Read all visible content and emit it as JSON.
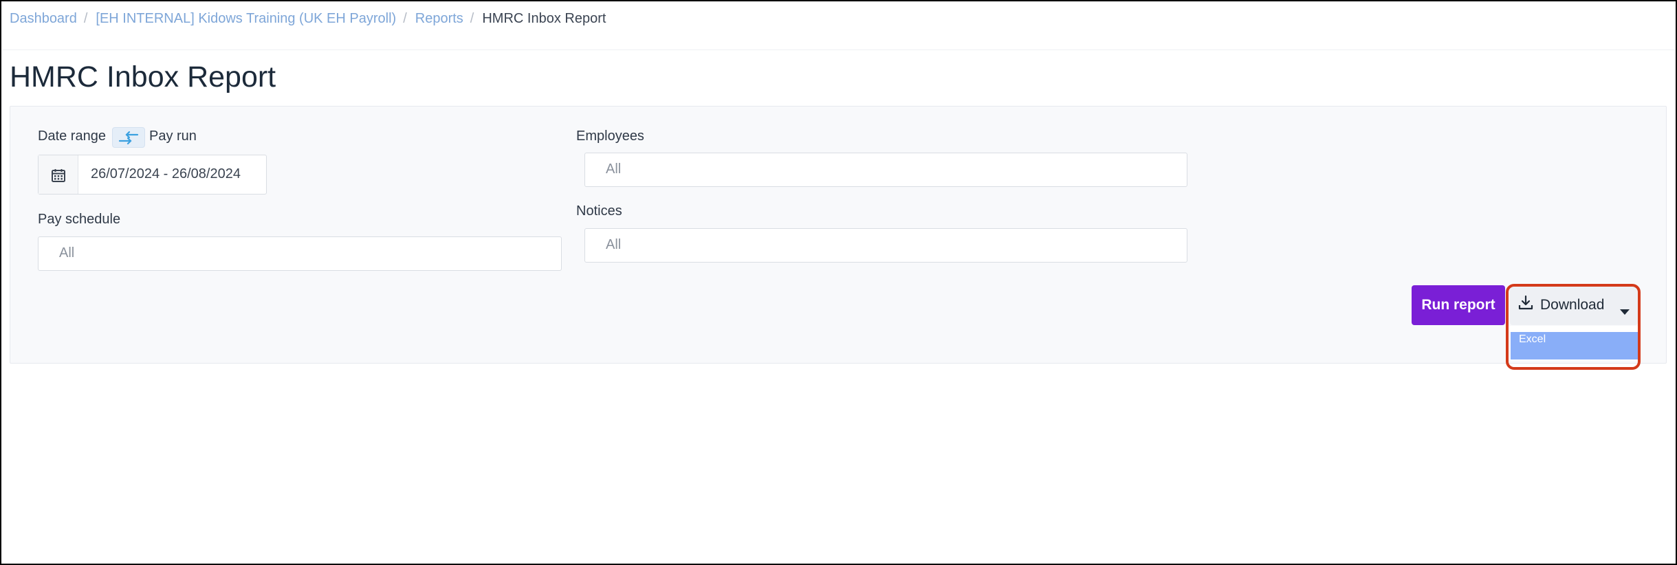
{
  "breadcrumb": {
    "items": [
      "Dashboard",
      "[EH INTERNAL] Kidows Training (UK EH Payroll)",
      "Reports"
    ],
    "separator": "/",
    "current": "HMRC Inbox Report"
  },
  "page": {
    "title": "HMRC Inbox Report"
  },
  "filters": {
    "date_range_label": "Date range",
    "pay_run_label": "Pay run",
    "date_range_value": "26/07/2024 - 26/08/2024",
    "pay_schedule_label": "Pay schedule",
    "pay_schedule_value": "All",
    "employees_label": "Employees",
    "employees_value": "All",
    "notices_label": "Notices",
    "notices_value": "All"
  },
  "actions": {
    "run_report_label": "Run report",
    "download_label": "Download",
    "download_options": [
      "Excel"
    ]
  },
  "colors": {
    "primary": "#7a1fd6",
    "link": "#7ea6d8",
    "dropdown_highlight": "#89aef8",
    "annotation": "#d43a1a"
  },
  "icons": {
    "toggle": "swap-arrows-icon",
    "date": "calendar-icon",
    "download": "download-icon",
    "caret": "caret-down-icon"
  }
}
